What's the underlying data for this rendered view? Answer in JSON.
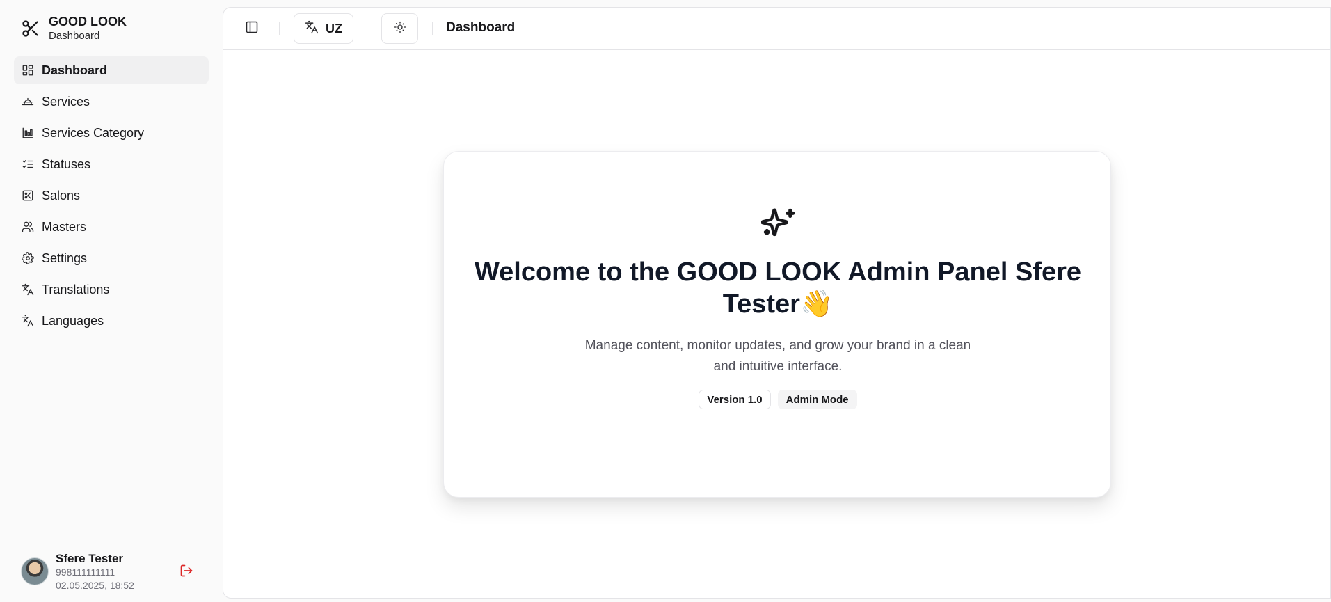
{
  "brand": {
    "title": "GOOD LOOK",
    "subtitle": "Dashboard",
    "icon": "scissors-icon"
  },
  "sidebar": {
    "items": [
      {
        "label": "Dashboard",
        "icon": "layout-dashboard-icon",
        "active": true
      },
      {
        "label": "Services",
        "icon": "hat-icon",
        "active": false
      },
      {
        "label": "Services Category",
        "icon": "chart-columns-icon",
        "active": false
      },
      {
        "label": "Statuses",
        "icon": "list-checks-icon",
        "active": false
      },
      {
        "label": "Salons",
        "icon": "scissors-square-icon",
        "active": false
      },
      {
        "label": "Masters",
        "icon": "users-icon",
        "active": false
      },
      {
        "label": "Settings",
        "icon": "gear-icon",
        "active": false
      },
      {
        "label": "Translations",
        "icon": "languages-icon",
        "active": false
      },
      {
        "label": "Languages",
        "icon": "languages-icon",
        "active": false
      }
    ]
  },
  "user": {
    "name": "Sfere Tester",
    "phone": "998111111111",
    "date": "02.05.2025, 18:52"
  },
  "topbar": {
    "language": "UZ",
    "title": "Dashboard"
  },
  "welcome": {
    "title": "Welcome to the GOOD LOOK Admin Panel Sfere Tester",
    "emoji": "👋",
    "description": "Manage content, monitor updates, and grow your brand in a clean and intuitive interface.",
    "badges": [
      "Version 1.0",
      "Admin Mode"
    ]
  },
  "colors": {
    "logout": "#dc2626",
    "active_bg": "#f0f0f1",
    "text": "#18181b"
  }
}
